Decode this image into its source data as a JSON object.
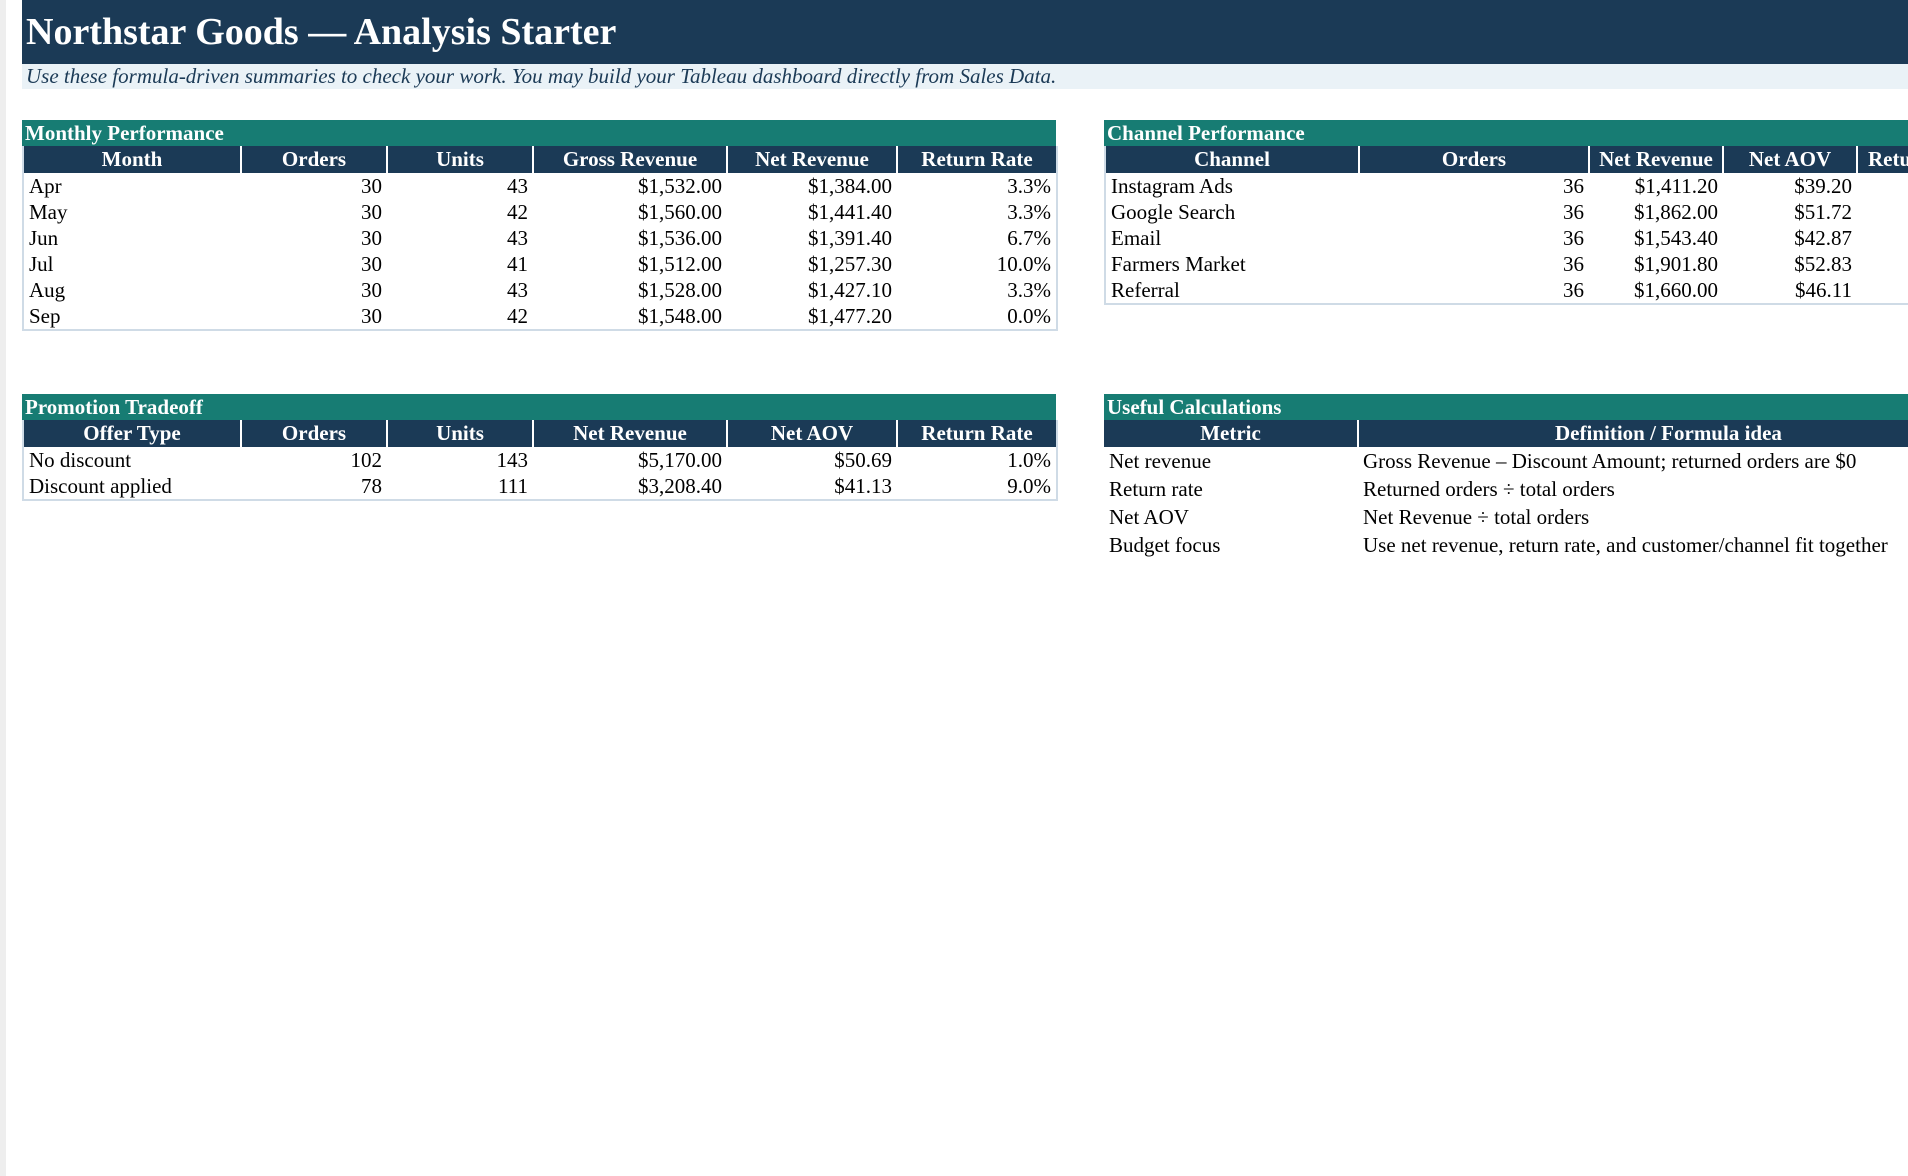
{
  "header": {
    "title": "Northstar Goods — Analysis Starter",
    "subtitle": "Use these formula-driven summaries to check your work. You may build your Tableau dashboard directly from Sales Data."
  },
  "monthly": {
    "title": "Monthly Performance",
    "columns": [
      "Month",
      "Orders",
      "Units",
      "Gross Revenue",
      "Net Revenue",
      "Return Rate"
    ],
    "rows": [
      [
        "Apr",
        "30",
        "43",
        "$1,532.00",
        "$1,384.00",
        "3.3%"
      ],
      [
        "May",
        "30",
        "42",
        "$1,560.00",
        "$1,441.40",
        "3.3%"
      ],
      [
        "Jun",
        "30",
        "43",
        "$1,536.00",
        "$1,391.40",
        "6.7%"
      ],
      [
        "Jul",
        "30",
        "41",
        "$1,512.00",
        "$1,257.30",
        "10.0%"
      ],
      [
        "Aug",
        "30",
        "43",
        "$1,528.00",
        "$1,427.10",
        "3.3%"
      ],
      [
        "Sep",
        "30",
        "42",
        "$1,548.00",
        "$1,477.20",
        "0.0%"
      ]
    ]
  },
  "channel": {
    "title": "Channel Performance",
    "columns": [
      "Channel",
      "Orders",
      "Net Revenue",
      "Net AOV",
      "Retu"
    ],
    "rows": [
      [
        "Instagram Ads",
        "36",
        "$1,411.20",
        "$39.20",
        ""
      ],
      [
        "Google Search",
        "36",
        "$1,862.00",
        "$51.72",
        ""
      ],
      [
        "Email",
        "36",
        "$1,543.40",
        "$42.87",
        ""
      ],
      [
        "Farmers Market",
        "36",
        "$1,901.80",
        "$52.83",
        ""
      ],
      [
        "Referral",
        "36",
        "$1,660.00",
        "$46.11",
        ""
      ]
    ]
  },
  "promotion": {
    "title": "Promotion Tradeoff",
    "columns": [
      "Offer Type",
      "Orders",
      "Units",
      "Net Revenue",
      "Net AOV",
      "Return Rate"
    ],
    "rows": [
      [
        "No discount",
        "102",
        "143",
        "$5,170.00",
        "$50.69",
        "1.0%"
      ],
      [
        "Discount applied",
        "78",
        "111",
        "$3,208.40",
        "$41.13",
        "9.0%"
      ]
    ]
  },
  "useful": {
    "title": "Useful Calculations",
    "columns": [
      "Metric",
      "Definition / Formula idea"
    ],
    "rows": [
      [
        "Net revenue",
        "Gross Revenue – Discount Amount; returned orders are $0"
      ],
      [
        "Return rate",
        "Returned orders ÷ total orders"
      ],
      [
        "Net AOV",
        "Net Revenue ÷ total orders"
      ],
      [
        "Budget focus",
        "Use net revenue, return rate, and customer/channel fit together"
      ]
    ]
  }
}
